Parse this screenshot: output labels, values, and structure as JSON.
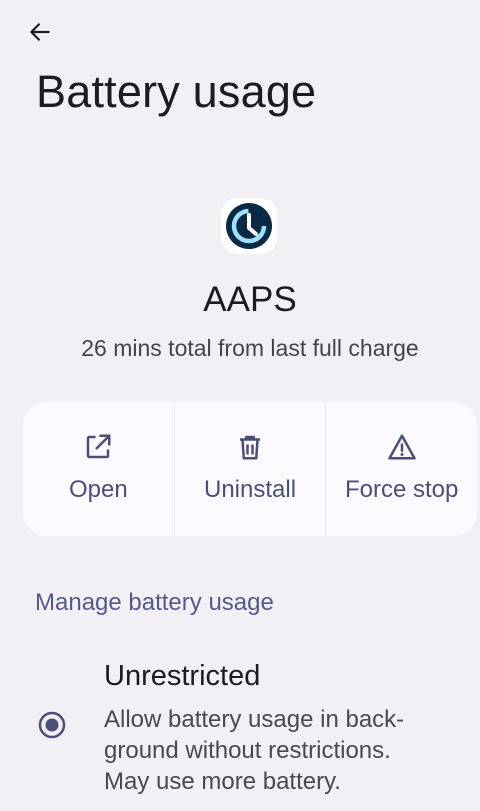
{
  "header": {
    "back_icon": "arrow-back-icon",
    "title": "Battery usage"
  },
  "app": {
    "icon": "aaps-app-icon",
    "name": "AAPS",
    "summary": "26 mins total from last full charge"
  },
  "actions": [
    {
      "label": "Open",
      "icon": "open-external-icon"
    },
    {
      "label": "Uninstall",
      "icon": "trash-icon"
    },
    {
      "label": "Force stop",
      "icon": "warning-icon"
    }
  ],
  "manage": {
    "header": "Manage battery usage",
    "options": [
      {
        "title": "Unrestricted",
        "description_lines": [
          "Allow battery usage in back-",
          "ground without restrictions.",
          "May use more battery."
        ],
        "selected": true
      }
    ]
  },
  "colors": {
    "background": "#f2eff5",
    "card": "#fcfaff",
    "accent": "#4b4f77",
    "section_header": "#555a88"
  }
}
